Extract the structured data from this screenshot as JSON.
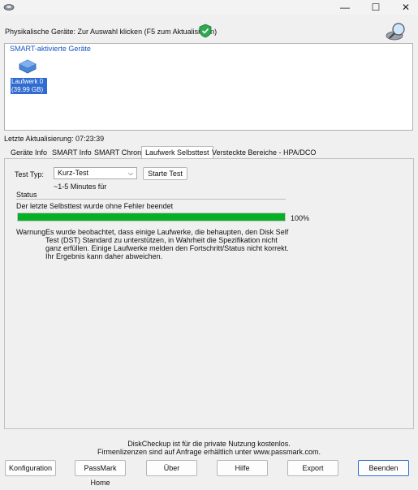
{
  "window": {
    "minimize_glyph": "—",
    "maximize_glyph": "☐",
    "close_glyph": "✕"
  },
  "header": {
    "devices_prompt": "Physikalische Geräte: Zur Auswahl klicken (F5 zum Aktualisieren)"
  },
  "devices": {
    "group_title": "SMART-aktivierte Geräte",
    "items": [
      {
        "line1": "Laufwerk 0",
        "line2": "(39.99 GB)"
      }
    ]
  },
  "last_update": "Letzte Aktualisierung: 07:23:39",
  "tabs": [
    {
      "label": "Geräte Info",
      "active": false
    },
    {
      "label": "SMART Info",
      "active": false
    },
    {
      "label": "SMART Chronik",
      "active": false
    },
    {
      "label": "Laufwerk Selbsttest",
      "active": true
    },
    {
      "label": "Versteckte Bereiche - HPA/DCO",
      "active": false
    }
  ],
  "selftest": {
    "test_type_label": "Test Typ:",
    "test_type_value": "Kurz-Test",
    "start_button": "Starte Test",
    "duration_hint": "~1-5 Minutes für",
    "status_label": "Status",
    "status_text": "Der letzte Selbsttest wurde ohne Fehler beendet",
    "progress_percent": 100,
    "progress_text": "100%",
    "warning_label": "Warnung",
    "warning_text": "Es wurde beobachtet, dass einige Laufwerke, die behaupten, den Disk Self Test (DST) Standard zu unterstützen, in Wahrheit die Spezifikation nicht ganz erfüllen. Einige Laufwerke melden den Fortschritt/Status nicht korrekt. Ihr Ergebnis kann daher abweichen."
  },
  "footer": {
    "line1": "DiskCheckup ist für die private Nutzung kostenlos.",
    "line2": "Firmenlizenzen sind auf Anfrage erhältlich unter www.passmark.com."
  },
  "buttons": {
    "config": "Konfiguration",
    "passmark_home": "PassMark Home",
    "about": "Über",
    "help": "Hilfe",
    "export": "Export",
    "quit": "Beenden"
  },
  "colors": {
    "progress_fill": "#06b025",
    "accent": "#2f6bd0",
    "group_title": "#1a56c4"
  }
}
